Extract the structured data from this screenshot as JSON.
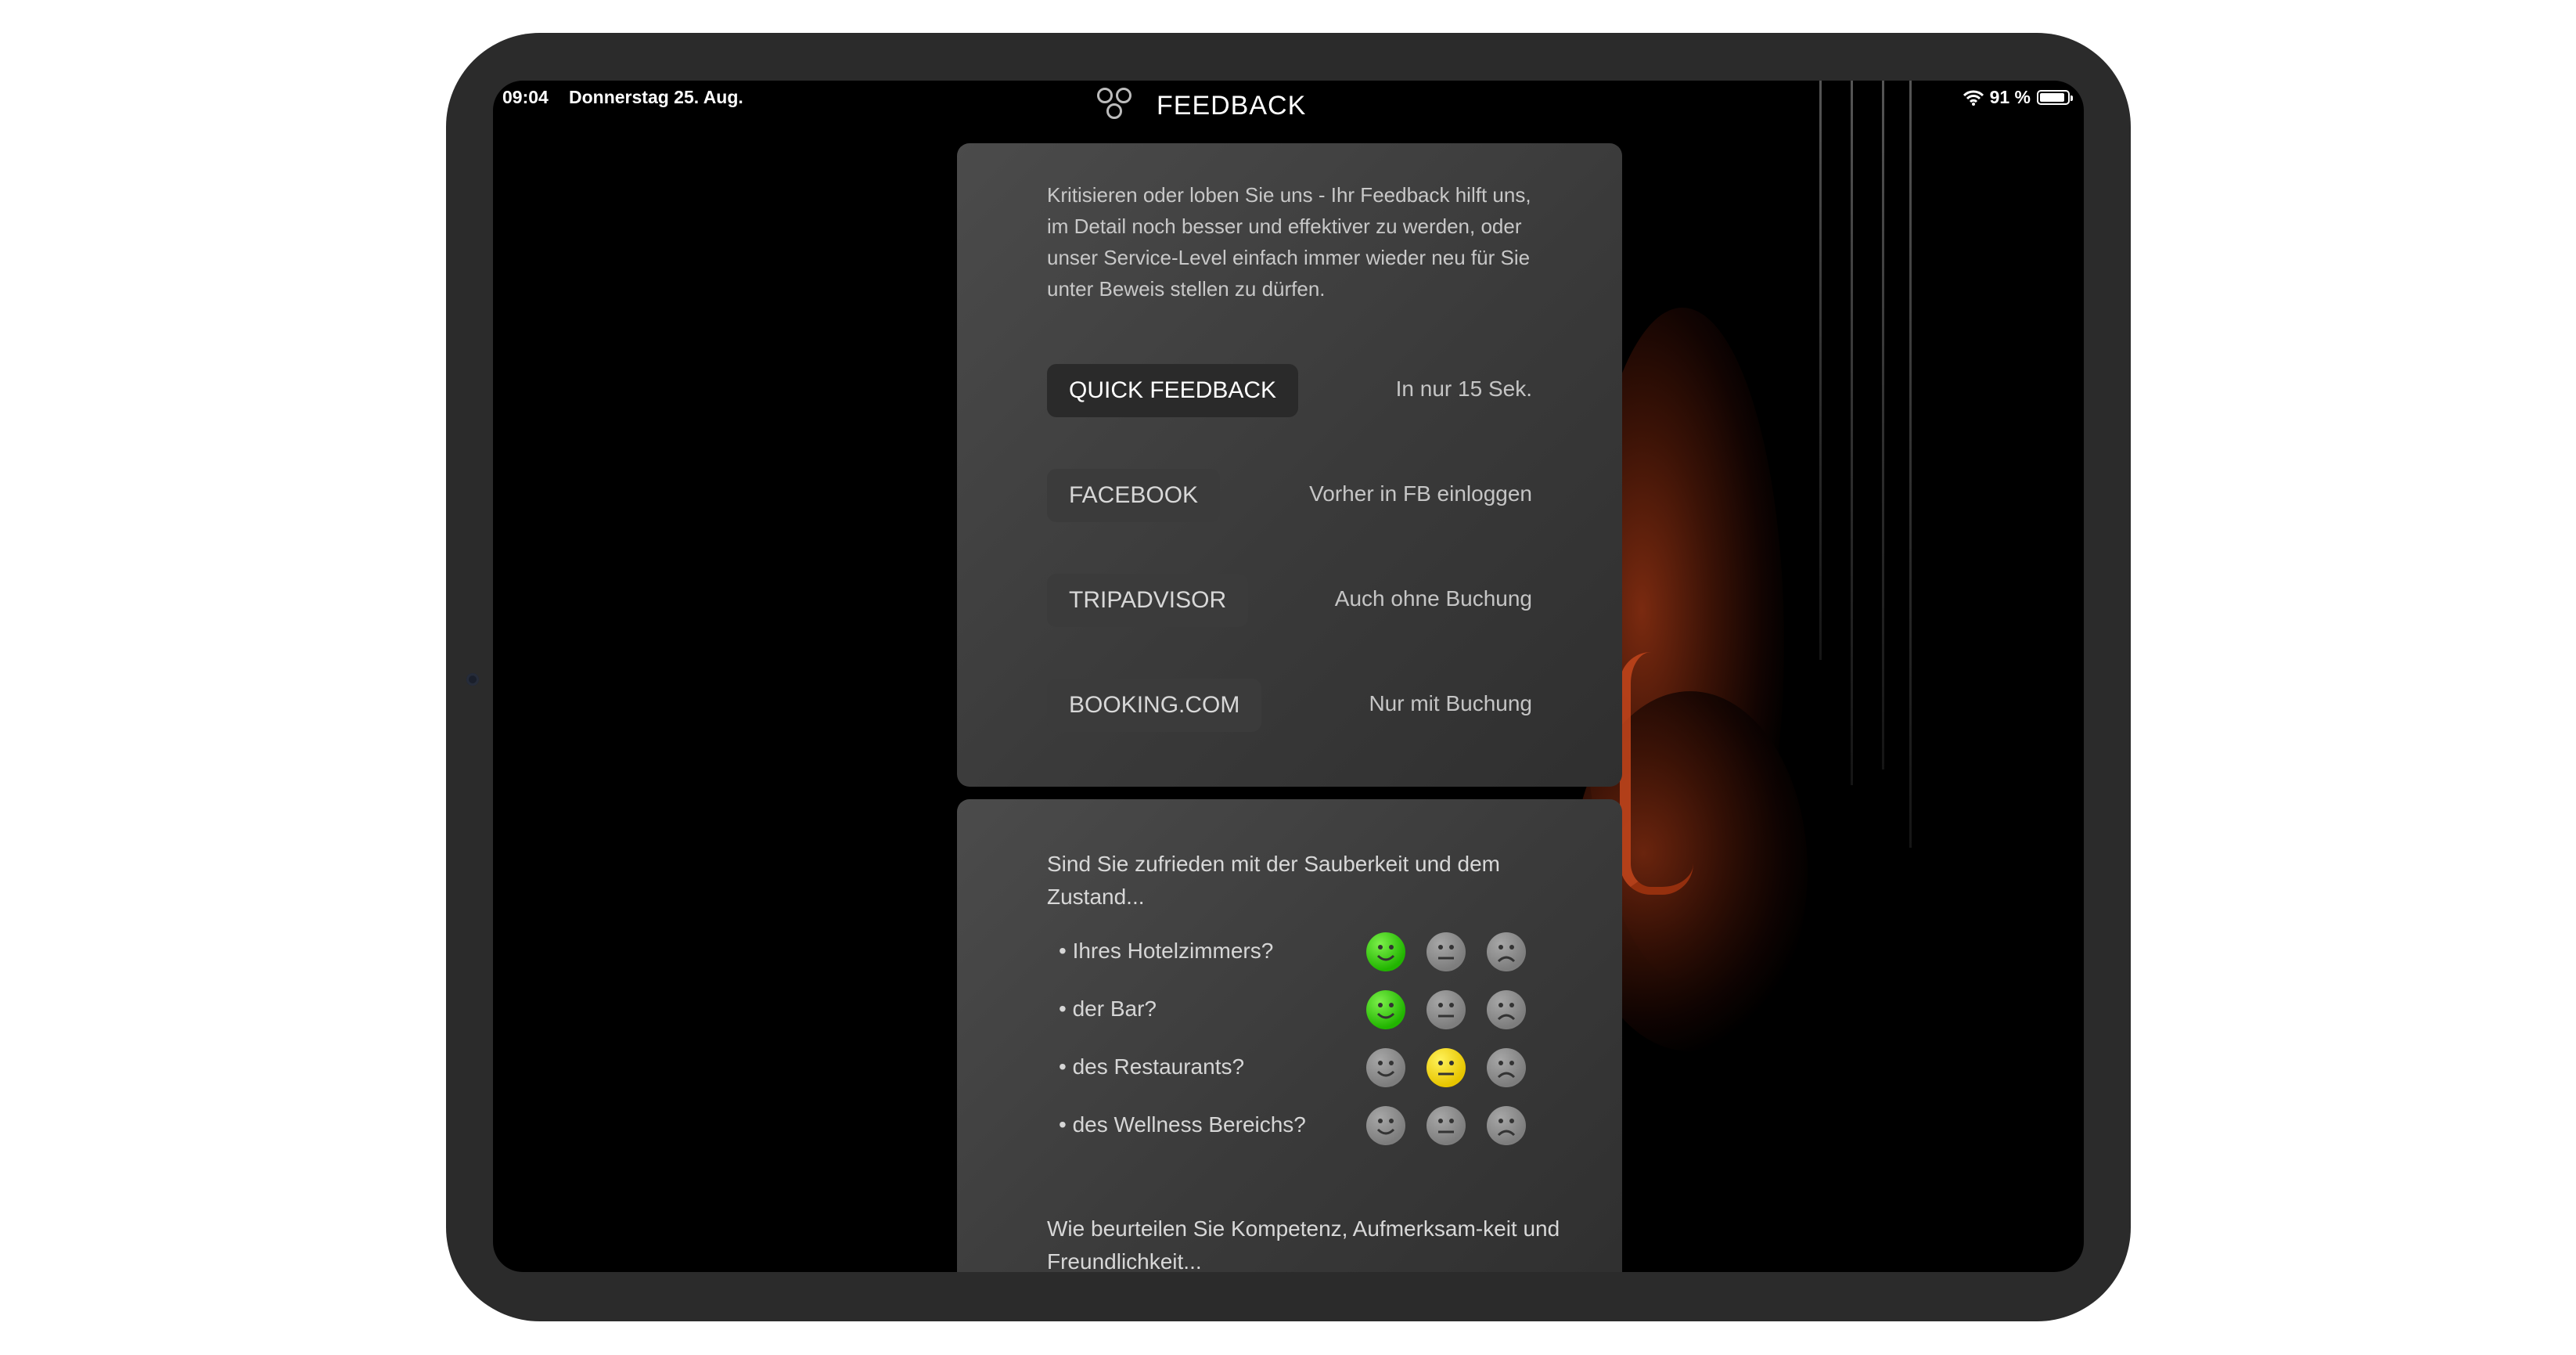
{
  "status_bar": {
    "time": "09:04",
    "date": "Donnerstag 25. Aug.",
    "wifi_icon": "wifi-icon",
    "battery_percent": "91 %",
    "battery_level": 0.91
  },
  "header": {
    "title": "FEEDBACK",
    "logo_icon": "three-rings-logo"
  },
  "intro": {
    "text": "Kritisieren oder loben Sie uns - Ihr Feedback hilft uns, im Detail noch besser und effektiver zu werden, oder unser Service-Level einfach immer wieder neu für Sie unter Beweis stellen zu dürfen."
  },
  "options": [
    {
      "label": "QUICK FEEDBACK",
      "hint": "In nur 15 Sek."
    },
    {
      "label": "FACEBOOK",
      "hint": "Vorher in FB einloggen"
    },
    {
      "label": "TRIPADVISOR",
      "hint": "Auch ohne Buchung"
    },
    {
      "label": "BOOKING.COM",
      "hint": "Nur mit Buchung"
    }
  ],
  "survey": {
    "question": "Sind Sie zufrieden mit der Sauberkeit und dem Zustand...",
    "items": [
      {
        "label": "• Ihres Hotelzimmers?",
        "selected": "happy"
      },
      {
        "label": "• der Bar?",
        "selected": "happy"
      },
      {
        "label": "• des Restaurants?",
        "selected": "neutral"
      },
      {
        "label": "• des Wellness Bereichs?",
        "selected": "none"
      }
    ],
    "rating_icons": [
      "happy-face-icon",
      "neutral-face-icon",
      "sad-face-icon"
    ],
    "next_question": "Wie beurteilen Sie Kompetenz, Aufmerksam-keit und Freundlichkeit..."
  },
  "colors": {
    "happy_selected": "#21b400",
    "neutral_selected": "#e7c500",
    "unselected": "#8a8a8a",
    "background": "#000000"
  }
}
